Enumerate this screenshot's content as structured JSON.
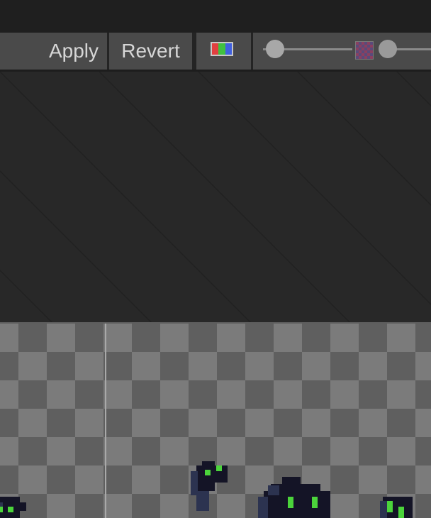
{
  "toolbar": {
    "apply_label": "Apply",
    "revert_label": "Revert",
    "channels_icon": "rgb-channels-icon",
    "mip_icon": "mip-level-icon"
  },
  "colors": {
    "title_bar": "#1f1f1f",
    "toolbar": "#3a3a3a",
    "panel": "#282828",
    "checker_dark": "#5f5f5f",
    "checker_light": "#7b7b7b",
    "sprite_dark": "#141426",
    "sprite_mid": "#2c3350",
    "sprite_eye": "#4bd43b"
  }
}
